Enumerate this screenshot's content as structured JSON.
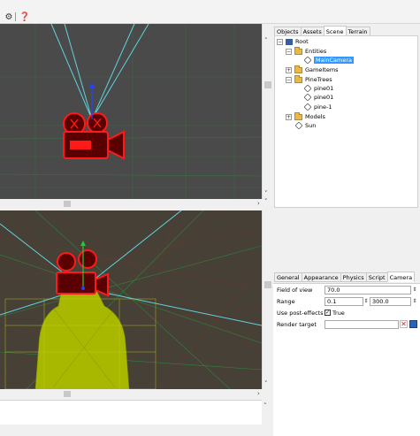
{
  "toolbar": {
    "settings_icon": "gear-icon",
    "help_icon": "help-icon",
    "settings_glyph": "⚙",
    "help_glyph": "❓"
  },
  "tabs": [
    {
      "label": "Objects",
      "active": false
    },
    {
      "label": "Assets",
      "active": false
    },
    {
      "label": "Scene",
      "active": true
    },
    {
      "label": "Terrain",
      "active": false
    }
  ],
  "tree": {
    "root": {
      "label": "Root",
      "expander": "−"
    },
    "entities": {
      "label": "Entities",
      "expander": "−"
    },
    "main_camera": {
      "label": "MainCamera",
      "selected": true
    },
    "game_items": {
      "label": "GameItems",
      "expander": "+"
    },
    "pine_trees": {
      "label": "PineTrees",
      "expander": "−"
    },
    "pine01_a": {
      "label": "pine01"
    },
    "pine01_b": {
      "label": "pine01"
    },
    "pine_1": {
      "label": "pine-1"
    },
    "models": {
      "label": "Models",
      "expander": "+"
    },
    "sun": {
      "label": "Sun"
    }
  },
  "prop_tabs": [
    {
      "label": "General",
      "active": false
    },
    {
      "label": "Appearance",
      "active": false
    },
    {
      "label": "Physics",
      "active": false
    },
    {
      "label": "Script",
      "active": false
    },
    {
      "label": "Camera",
      "active": true
    }
  ],
  "camera": {
    "fov_label": "Field of view",
    "fov_value": "70.0",
    "range_label": "Range",
    "range_min": "0.1",
    "range_max": "300.0",
    "post_label": "Use post-effects",
    "post_value": "True",
    "post_checked": "✓",
    "rt_label": "Render target",
    "rt_value": "",
    "clear_glyph": "✕"
  },
  "scroll": {
    "up": "˄",
    "down": "˅",
    "right": "›"
  },
  "colors": {
    "viewport_bg": "#4a4a4a",
    "grid_green": "#2e8b3e",
    "camera_red": "#ff1a1a",
    "frustum_cyan": "#5fd3e0",
    "mesh_yellow": "#b5c400",
    "selection_blue": "#3399ff"
  }
}
